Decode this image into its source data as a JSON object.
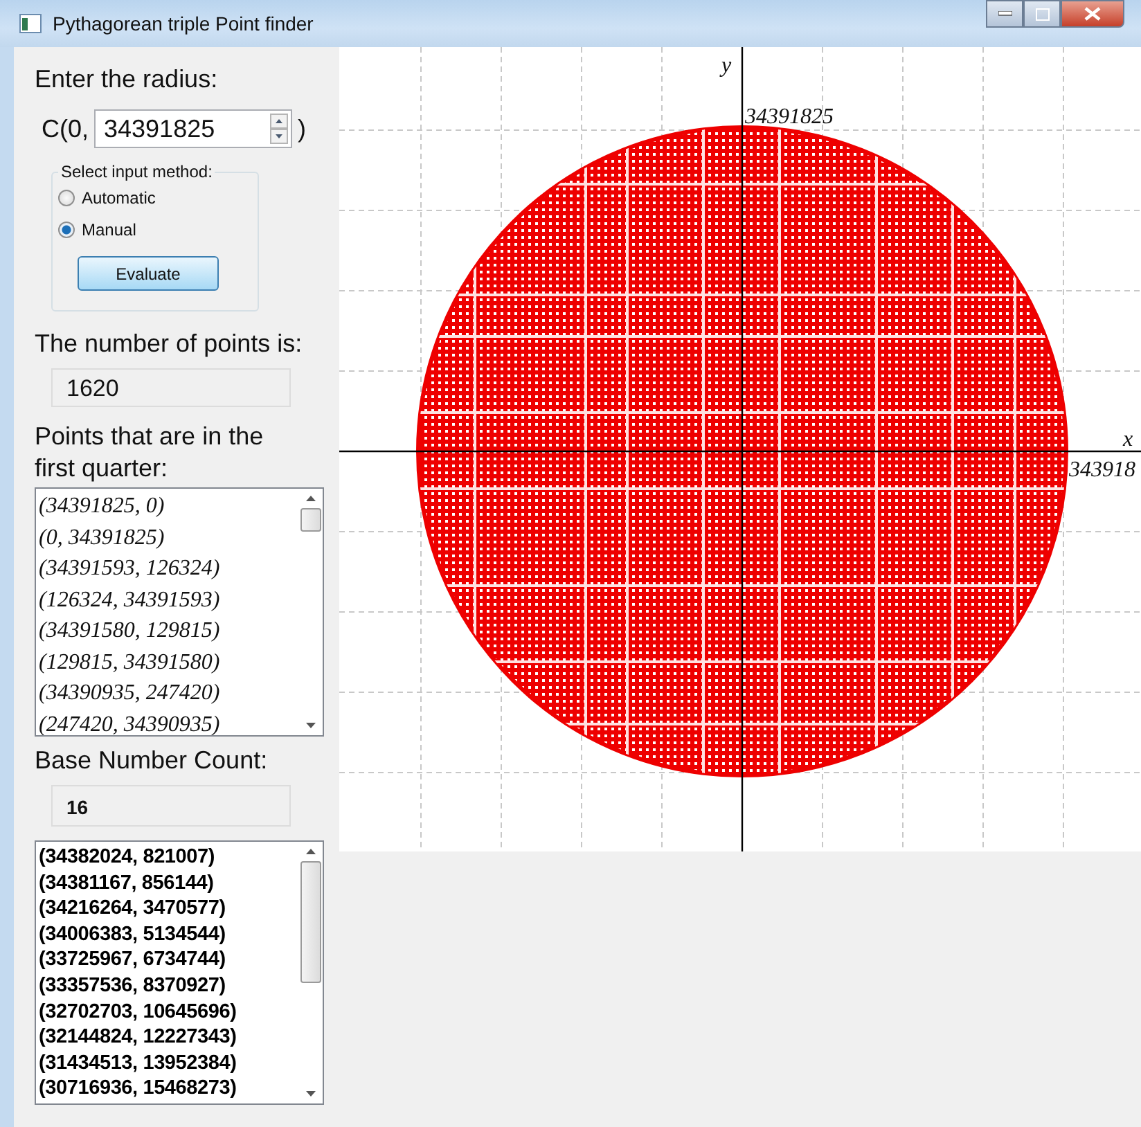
{
  "window": {
    "title": "Pythagorean triple Point finder"
  },
  "radius_section": {
    "label": "Enter the radius:",
    "prefix": "C(0,",
    "value": "34391825",
    "suffix": ")"
  },
  "input_method": {
    "legend": "Select input method:",
    "options": [
      {
        "label": "Automatic",
        "selected": false
      },
      {
        "label": "Manual",
        "selected": true
      }
    ]
  },
  "evaluate_button": "Evaluate",
  "points_count": {
    "label": "The number of points is:",
    "value": "1620"
  },
  "first_quarter": {
    "label": "Points that are in the first quarter:",
    "items": [
      "(34391825, 0)",
      "(0, 34391825)",
      "(34391593, 126324)",
      "(126324, 34391593)",
      "(34391580, 129815)",
      "(129815, 34391580)",
      "(34390935, 247420)",
      "(247420, 34390935)"
    ]
  },
  "base_count": {
    "label": "Base Number Count:",
    "value": "16"
  },
  "base_list": {
    "items": [
      "(34382024, 821007)",
      "(34381167, 856144)",
      "(34216264, 3470577)",
      "(34006383, 5134544)",
      "(33725967, 6734744)",
      "(33357536, 8370927)",
      "(32702703, 10645696)",
      "(32144824, 12227343)",
      "(31434513, 13952384)",
      "(30716936, 15468273)"
    ]
  },
  "plot": {
    "y_label": "y",
    "x_label": "x",
    "y_max_label": "34391825",
    "x_max_label": "343918"
  }
}
